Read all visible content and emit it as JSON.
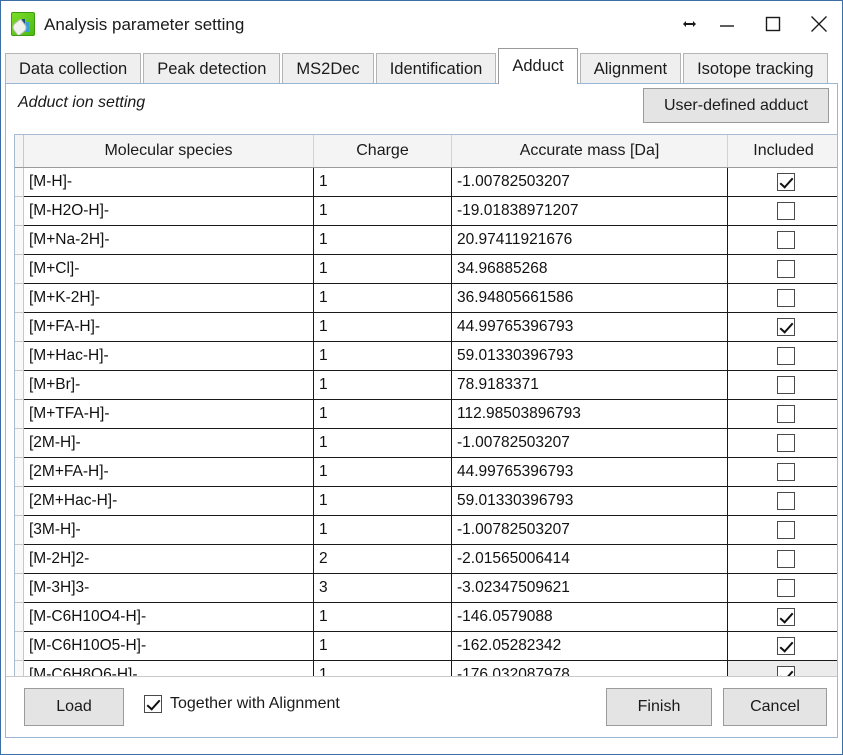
{
  "window": {
    "title": "Analysis parameter setting",
    "icon": "analysis-app-icon",
    "controls": {
      "resize": "resize-handle-icon",
      "minimize": "minimize-icon",
      "maximize": "maximize-icon",
      "close": "close-icon"
    }
  },
  "tabs": [
    {
      "label": "Data collection",
      "selected": false
    },
    {
      "label": "Peak detection",
      "selected": false
    },
    {
      "label": "MS2Dec",
      "selected": false
    },
    {
      "label": "Identification",
      "selected": false
    },
    {
      "label": "Adduct",
      "selected": true
    },
    {
      "label": "Alignment",
      "selected": false
    },
    {
      "label": "Isotope tracking",
      "selected": false
    }
  ],
  "page": {
    "section_label": "Adduct ion setting",
    "user_defined_button": "User-defined adduct"
  },
  "grid": {
    "columns": [
      "Molecular species",
      "Charge",
      "Accurate mass [Da]",
      "Included"
    ],
    "rows": [
      {
        "species": "[M-H]-",
        "charge": "1",
        "mass": "-1.00782503207",
        "included": true,
        "current": false
      },
      {
        "species": "[M-H2O-H]-",
        "charge": "1",
        "mass": "-19.01838971207",
        "included": false,
        "current": false
      },
      {
        "species": "[M+Na-2H]-",
        "charge": "1",
        "mass": "20.97411921676",
        "included": false,
        "current": false
      },
      {
        "species": "[M+Cl]-",
        "charge": "1",
        "mass": "34.96885268",
        "included": false,
        "current": false
      },
      {
        "species": "[M+K-2H]-",
        "charge": "1",
        "mass": "36.94805661586",
        "included": false,
        "current": false
      },
      {
        "species": "[M+FA-H]-",
        "charge": "1",
        "mass": "44.99765396793",
        "included": true,
        "current": false
      },
      {
        "species": "[M+Hac-H]-",
        "charge": "1",
        "mass": "59.01330396793",
        "included": false,
        "current": false
      },
      {
        "species": "[M+Br]-",
        "charge": "1",
        "mass": "78.9183371",
        "included": false,
        "current": false
      },
      {
        "species": "[M+TFA-H]-",
        "charge": "1",
        "mass": "112.98503896793",
        "included": false,
        "current": false
      },
      {
        "species": "[2M-H]-",
        "charge": "1",
        "mass": "-1.00782503207",
        "included": false,
        "current": false
      },
      {
        "species": "[2M+FA-H]-",
        "charge": "1",
        "mass": "44.99765396793",
        "included": false,
        "current": false
      },
      {
        "species": "[2M+Hac-H]-",
        "charge": "1",
        "mass": "59.01330396793",
        "included": false,
        "current": false
      },
      {
        "species": "[3M-H]-",
        "charge": "1",
        "mass": "-1.00782503207",
        "included": false,
        "current": false
      },
      {
        "species": "[M-2H]2-",
        "charge": "2",
        "mass": "-2.01565006414",
        "included": false,
        "current": false
      },
      {
        "species": "[M-3H]3-",
        "charge": "3",
        "mass": "-3.02347509621",
        "included": false,
        "current": false
      },
      {
        "species": "[M-C6H10O4-H]-",
        "charge": "1",
        "mass": "-146.0579088",
        "included": true,
        "current": false
      },
      {
        "species": "[M-C6H10O5-H]-",
        "charge": "1",
        "mass": "-162.05282342",
        "included": true,
        "current": false
      },
      {
        "species": "[M-C6H8O6-H]-",
        "charge": "1",
        "mass": "-176.032087978",
        "included": true,
        "current": true
      }
    ]
  },
  "footer": {
    "load_label": "Load",
    "together_checkbox_label": "Together with Alignment",
    "together_checked": true,
    "finish_label": "Finish",
    "cancel_label": "Cancel"
  },
  "colors": {
    "window_border": "#3a6ea5",
    "tab_selected_bg": "#ffffff",
    "tab_bg": "#efefef",
    "button_bg": "#e4e4e4",
    "grid_header_bg": "#f4f4f4",
    "current_cell_bg": "#ececec"
  }
}
